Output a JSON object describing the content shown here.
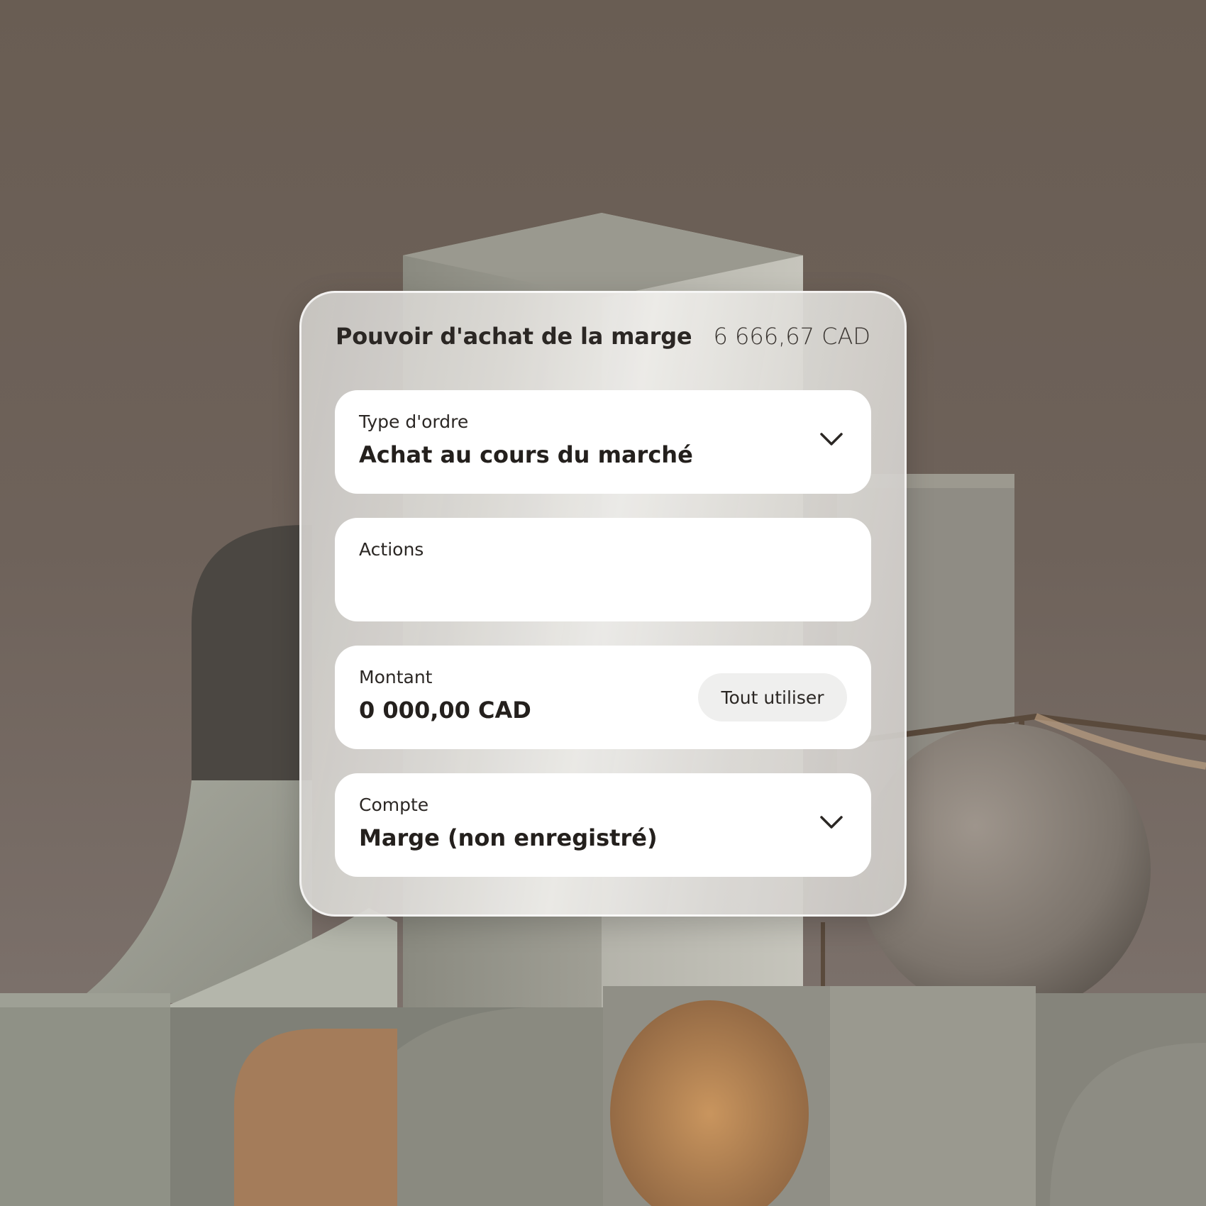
{
  "scene": {
    "description_icon": "concrete-sculpture-background"
  },
  "panel": {
    "title": "Pouvoir d'achat de la marge",
    "buying_power": "6 666,67 CAD"
  },
  "fields": {
    "order_type": {
      "label": "Type d'ordre",
      "value": "Achat au cours du marché",
      "icon": "chevron-down-icon"
    },
    "shares": {
      "label": "Actions",
      "value": ""
    },
    "amount": {
      "label": "Montant",
      "value": "0 000,00 CAD",
      "use_all_label": "Tout utiliser"
    },
    "account": {
      "label": "Compte",
      "value": "Marge (non enregistré)",
      "icon": "chevron-down-icon"
    }
  },
  "colors": {
    "background": "#6b5f55",
    "field_background": "#ffffff",
    "text_primary": "#24201d",
    "pill_background": "#efefee"
  }
}
